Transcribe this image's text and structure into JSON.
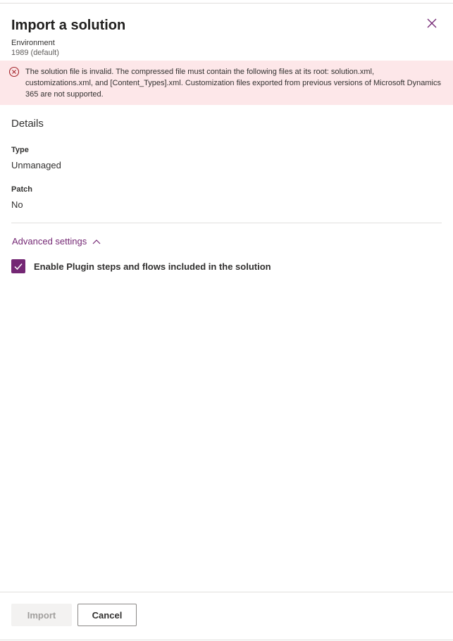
{
  "dialog": {
    "title": "Import a solution",
    "environment_label": "Environment",
    "environment_value": "1989 (default)",
    "close_icon": "close-icon"
  },
  "error": {
    "icon": "error-circle-icon",
    "message": "The solution file is invalid. The compressed file must contain the following files at its root: solution.xml, customizations.xml, and [Content_Types].xml. Customization files exported from previous versions of Microsoft Dynamics 365 are not supported.",
    "color": "#fde7e9"
  },
  "details": {
    "heading": "Details",
    "type_label": "Type",
    "type_value": "Unmanaged",
    "patch_label": "Patch",
    "patch_value": "No"
  },
  "advanced": {
    "label": "Advanced settings",
    "expanded": true,
    "checkbox_label": "Enable Plugin steps and flows included in the solution",
    "checkbox_checked": true
  },
  "footer": {
    "import_label": "Import",
    "import_disabled": true,
    "cancel_label": "Cancel"
  },
  "colors": {
    "accent": "#742774",
    "error_background": "#fde7e9",
    "error_icon": "#a4262c"
  }
}
